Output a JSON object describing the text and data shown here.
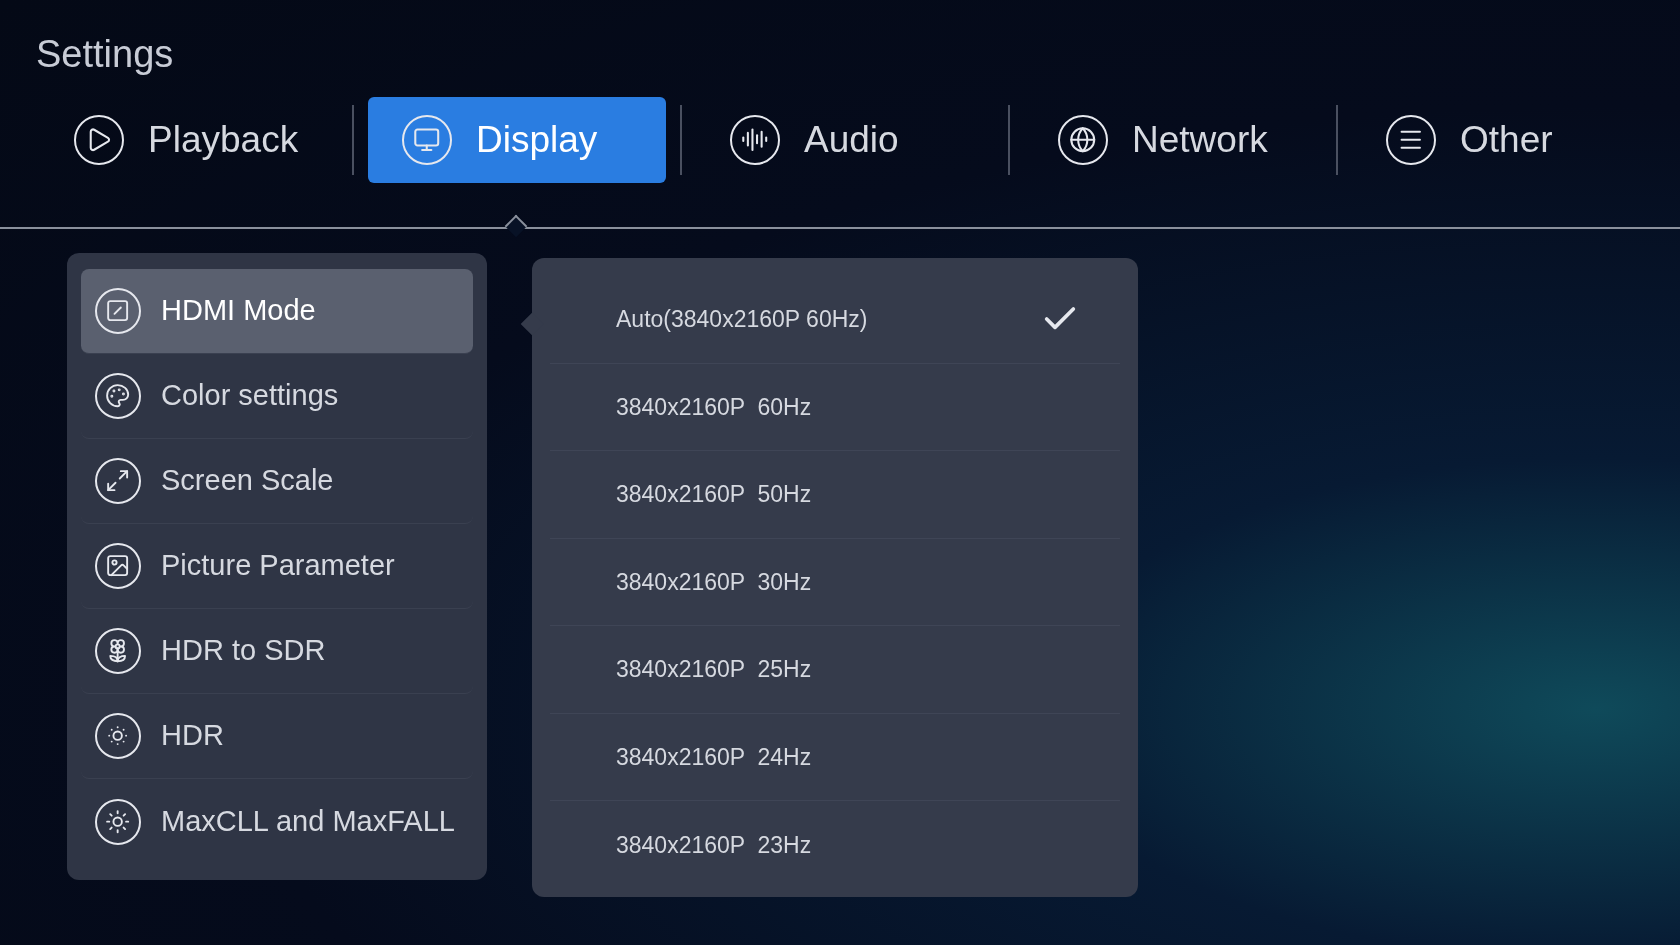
{
  "title": "Settings",
  "tabs": [
    {
      "label": "Playback",
      "selected": false
    },
    {
      "label": "Display",
      "selected": true
    },
    {
      "label": "Audio",
      "selected": false
    },
    {
      "label": "Network",
      "selected": false
    },
    {
      "label": "Other",
      "selected": false
    }
  ],
  "menu": [
    {
      "label": "HDMI Mode",
      "selected": true
    },
    {
      "label": "Color settings",
      "selected": false
    },
    {
      "label": "Screen Scale",
      "selected": false
    },
    {
      "label": "Picture Parameter",
      "selected": false
    },
    {
      "label": "HDR to SDR",
      "selected": false
    },
    {
      "label": "HDR",
      "selected": false
    },
    {
      "label": "MaxCLL and MaxFALL",
      "selected": false
    }
  ],
  "options": [
    {
      "label": "Auto(3840x2160P 60Hz)",
      "checked": true
    },
    {
      "label": "3840x2160P  60Hz",
      "checked": false
    },
    {
      "label": "3840x2160P  50Hz",
      "checked": false
    },
    {
      "label": "3840x2160P  30Hz",
      "checked": false
    },
    {
      "label": "3840x2160P  25Hz",
      "checked": false
    },
    {
      "label": "3840x2160P  24Hz",
      "checked": false
    },
    {
      "label": "3840x2160P  23Hz",
      "checked": false
    }
  ]
}
